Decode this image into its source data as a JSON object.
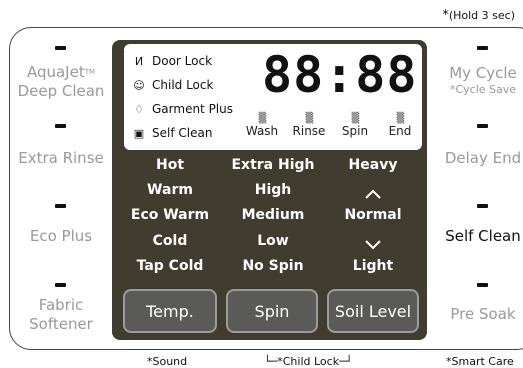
{
  "header_hint": {
    "star": "*",
    "text": "(Hold 3 sec)"
  },
  "left_options": [
    {
      "line1": "AquaJet",
      "tm": "TM",
      "line2": "Deep Clean"
    },
    {
      "line1": "Extra Rinse"
    },
    {
      "line1": "Eco Plus"
    },
    {
      "line1": "Fabric",
      "line2": "Softener"
    }
  ],
  "right_options": [
    {
      "line1": "My Cycle",
      "sub": "*Cycle Save"
    },
    {
      "line1": "Delay End"
    },
    {
      "line1": "Self Clean",
      "active": true
    },
    {
      "line1": "Pre Soak"
    }
  ],
  "display": {
    "indicators": [
      "Door Lock",
      "Child Lock",
      "Garment Plus",
      "Self Clean"
    ],
    "digits": "88:88",
    "stages": [
      "Wash",
      "Rinse",
      "Spin",
      "End"
    ]
  },
  "icons": {
    "door_lock": "key-icon",
    "child_lock": "child-face-icon",
    "garment_plus": "shirt-plus-icon",
    "self_clean": "drum-clean-icon",
    "stage": "water-flow-icon"
  },
  "temp_options": [
    "Hot",
    "Warm",
    "Eco Warm",
    "Cold",
    "Tap Cold"
  ],
  "spin_options": [
    "Extra High",
    "High",
    "Medium",
    "Low",
    "No Spin"
  ],
  "soil_options": [
    "Heavy",
    "Normal",
    "Light"
  ],
  "buttons": {
    "temp": "Temp.",
    "spin": "Spin",
    "soil": "Soil Level"
  },
  "footer_hints": {
    "sound": "*Sound",
    "child_lock": "*Child Lock",
    "smart_care": "*Smart Care"
  },
  "colors": {
    "panel": "#403d30",
    "button": "#5a5a56",
    "inactive_text": "#9a9a9a"
  }
}
